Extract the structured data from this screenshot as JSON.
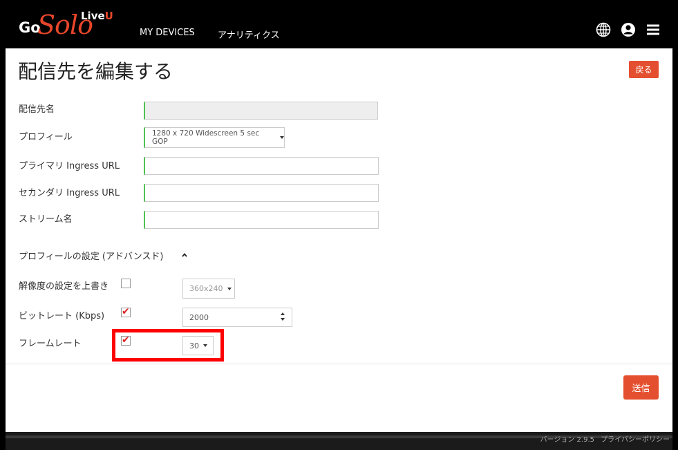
{
  "header": {
    "logo_go": "Go",
    "logo_solo": "Solo",
    "logo_live": "Live",
    "logo_u": "U",
    "nav_items": [
      "MY DEVICES",
      "アナリティクス"
    ],
    "icons": [
      "globe-icon",
      "user-icon",
      "menu-icon"
    ]
  },
  "page": {
    "title": "配信先を編集する",
    "back_label": "戻る"
  },
  "form": {
    "destination_name_label": "配信先名",
    "destination_name_value": "",
    "profile_label": "プロフィール",
    "profile_value": "1280 x 720 Widescreen 5 sec GOP",
    "primary_url_label": "プライマリ Ingress URL",
    "primary_url_value": "",
    "secondary_url_label": "セカンダリ Ingress URL",
    "secondary_url_value": "",
    "stream_name_label": "ストリーム名",
    "stream_name_value": ""
  },
  "advanced": {
    "section_title": "プロフィールの設定 (アドバンスド)",
    "resolution_label": "解像度の設定を上書き",
    "resolution_checked": false,
    "resolution_value": "360x240",
    "bitrate_label": "ビットレート (Kbps)",
    "bitrate_checked": true,
    "bitrate_value": "2000",
    "framerate_label": "フレームレート",
    "framerate_checked": true,
    "framerate_value": "30"
  },
  "actions": {
    "submit_label": "送信"
  },
  "footer": {
    "version": "バージョン 2.9.5",
    "privacy": "プライバシーポリシー"
  },
  "colors": {
    "accent": "#e4502f",
    "field_focus": "#4cc34f",
    "highlight": "#ff0000"
  }
}
